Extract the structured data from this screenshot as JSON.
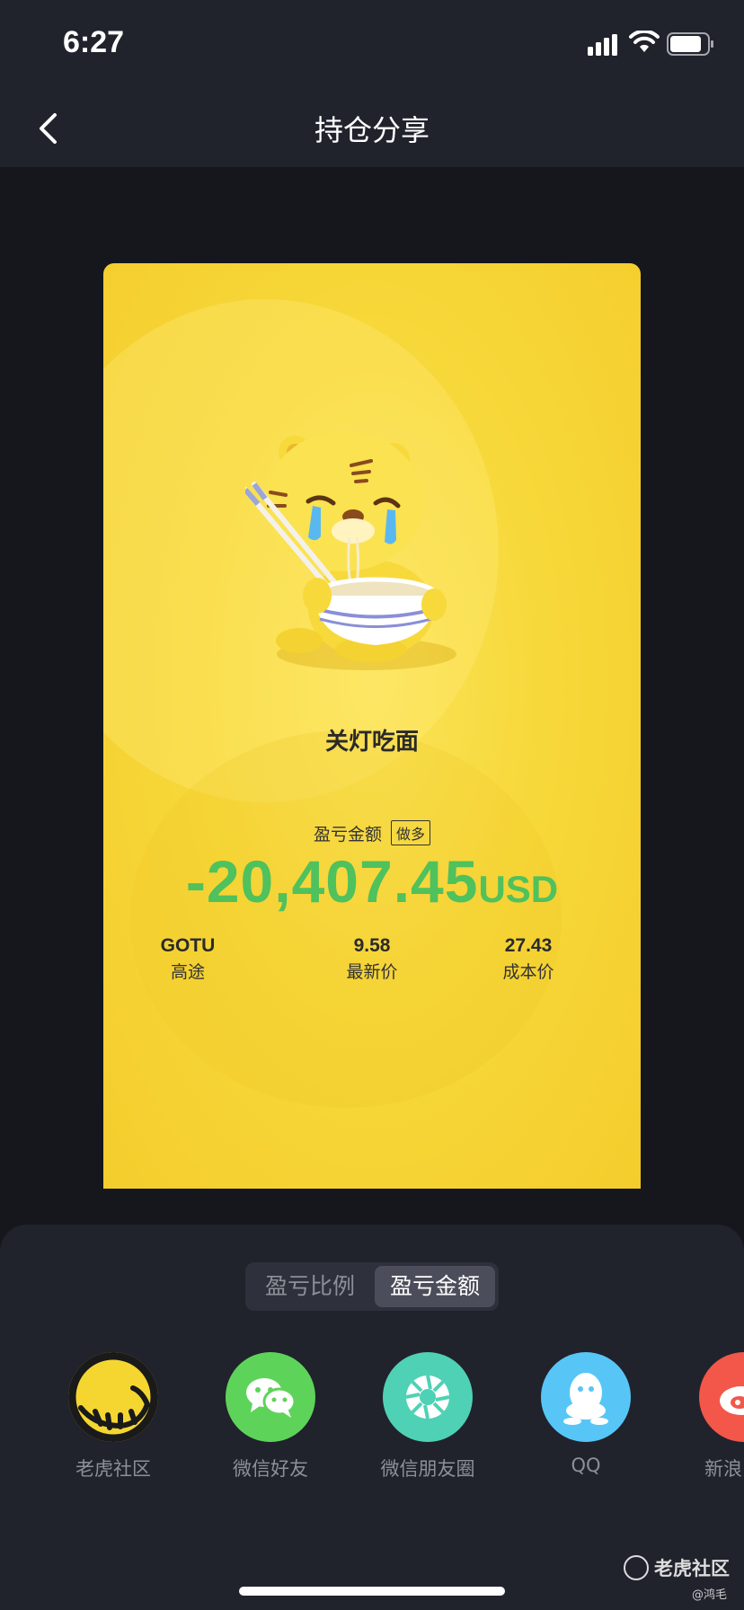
{
  "status": {
    "time": "6:27"
  },
  "nav": {
    "title": "持仓分享"
  },
  "card": {
    "mood_title": "关灯吃面",
    "pl_label": "盈亏金额",
    "direction_badge": "做多",
    "pl_value": "-20,407.45",
    "pl_currency": "USD",
    "pl_color": "#4fc15d",
    "stats": [
      {
        "top": "GOTU",
        "bottom": "高途"
      },
      {
        "top": "9.58",
        "bottom": "最新价"
      },
      {
        "top": "27.43",
        "bottom": "成本价"
      }
    ]
  },
  "toggle": {
    "options": [
      "盈亏比例",
      "盈亏金额"
    ],
    "selected": "盈亏金额"
  },
  "share": [
    {
      "label": "老虎社区",
      "icon": "tiger-community-icon",
      "color": "#f5d631"
    },
    {
      "label": "微信好友",
      "icon": "wechat-icon",
      "color": "#5ed35a"
    },
    {
      "label": "微信朋友圈",
      "icon": "wechat-moments-icon",
      "color": "#4fd1b5"
    },
    {
      "label": "QQ",
      "icon": "qq-icon",
      "color": "#57c6f6"
    },
    {
      "label": "新浪",
      "icon": "weibo-icon",
      "color": "#f2574a"
    }
  ],
  "watermark": {
    "text": "老虎社区",
    "user": "@鸿毛"
  }
}
